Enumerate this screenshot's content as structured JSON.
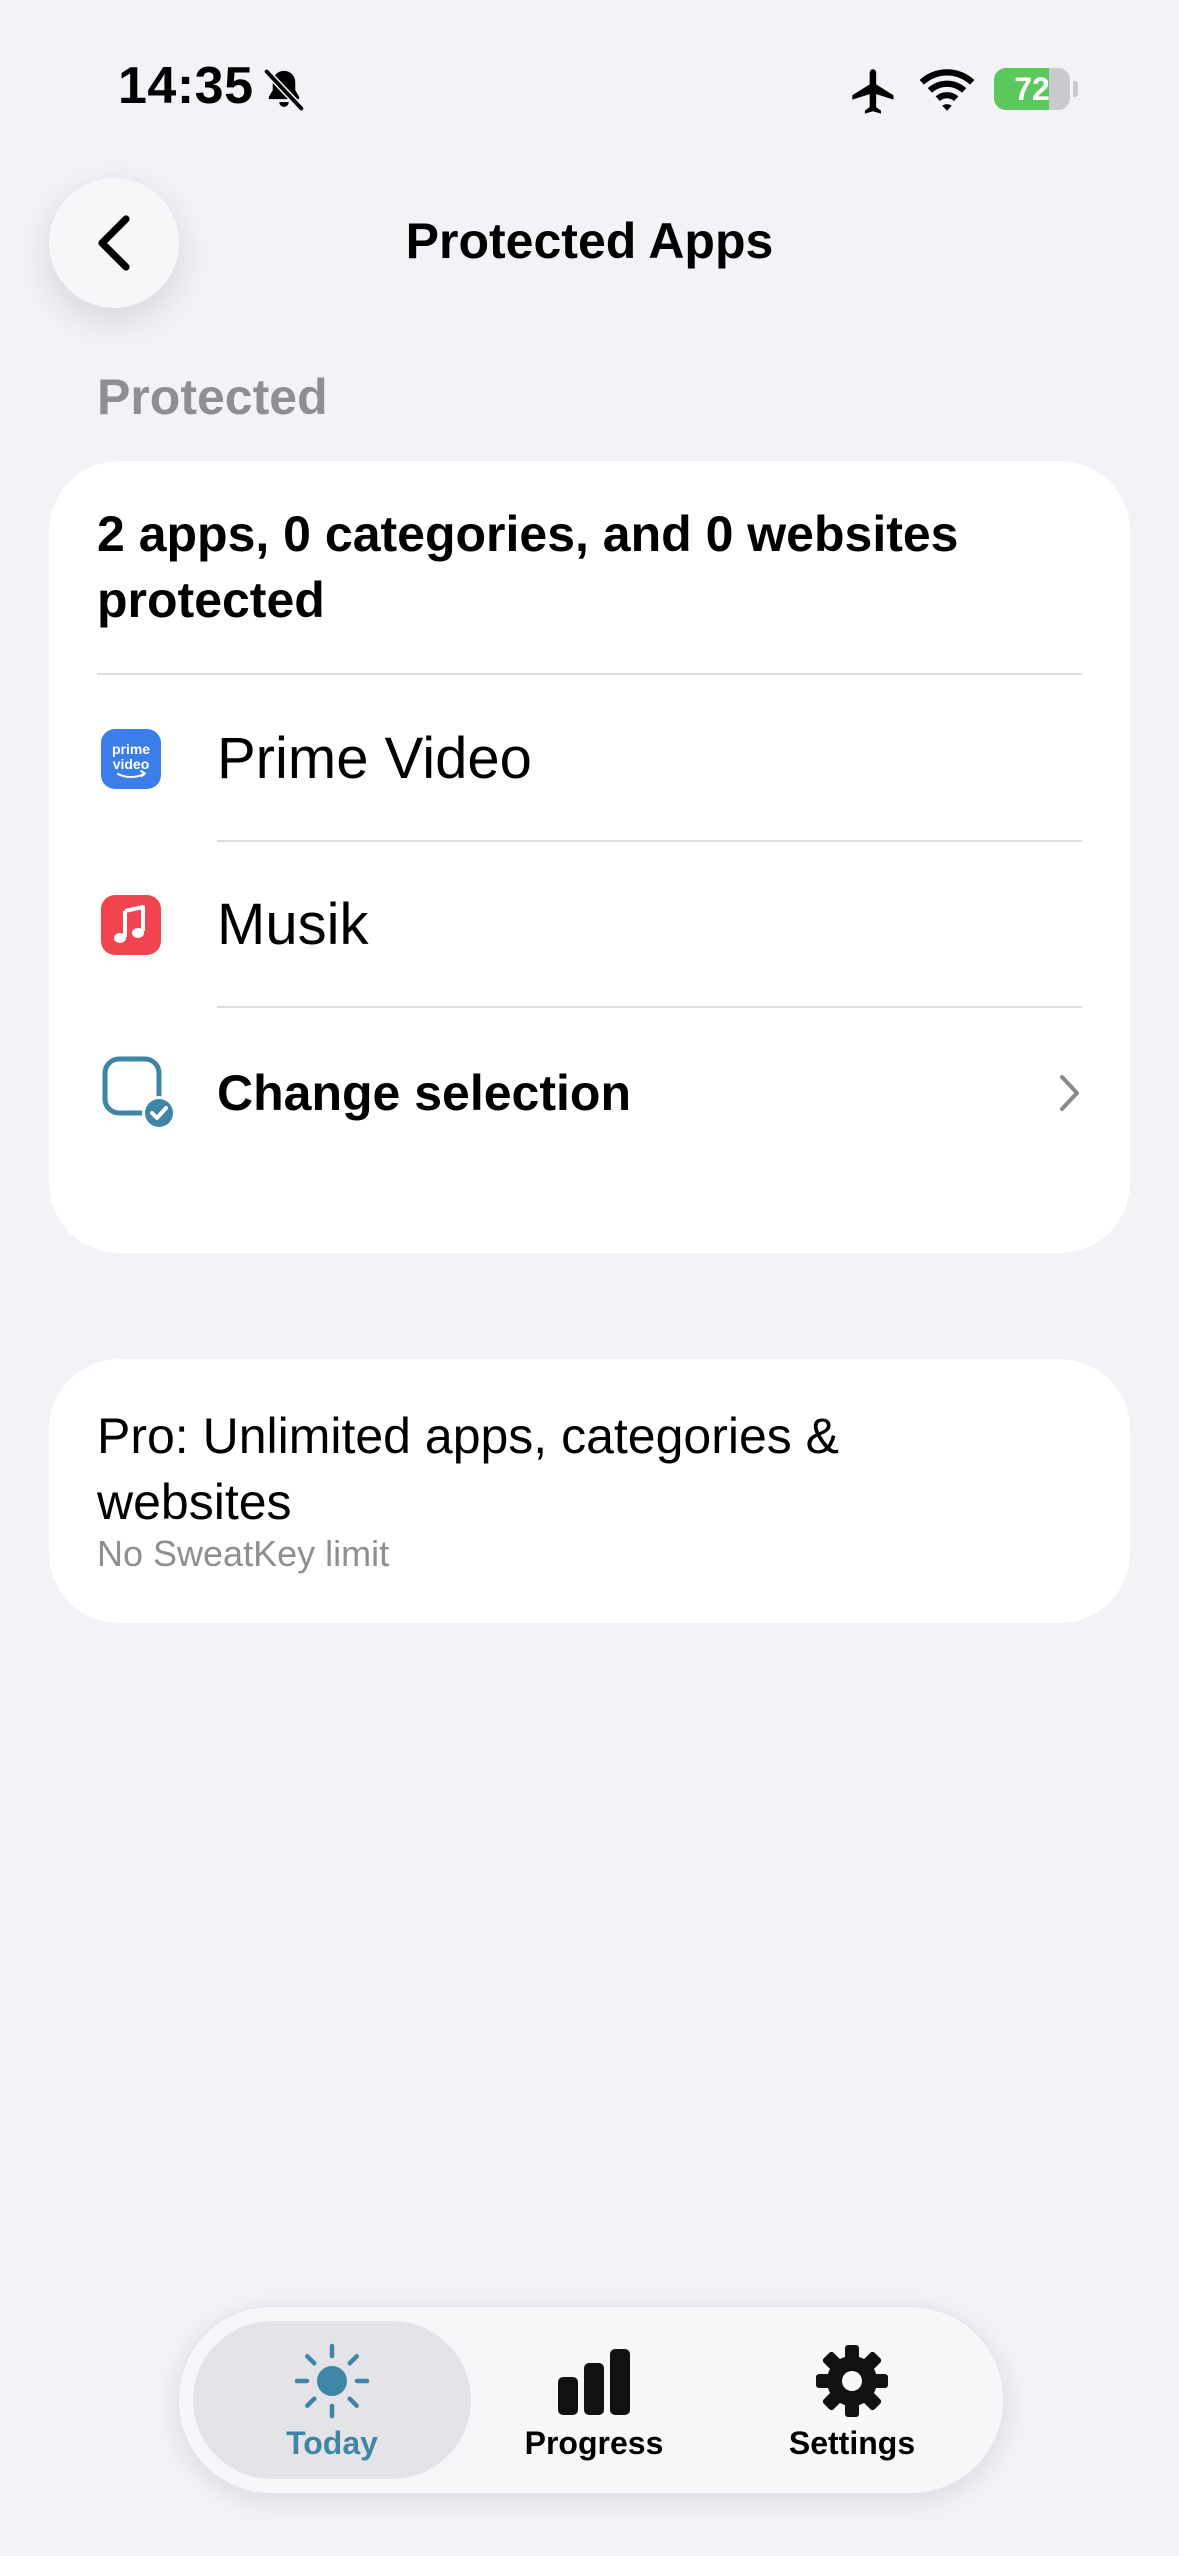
{
  "status_bar": {
    "time": "14:35",
    "battery": "72",
    "battery_level_percent": 72,
    "icons": [
      "bell-off-icon",
      "airplane-icon",
      "wifi-icon",
      "battery-charging-icon"
    ]
  },
  "nav": {
    "title": "Protected Apps",
    "back_icon": "chevron-left-icon"
  },
  "section": {
    "title": "Protected"
  },
  "protected_card": {
    "summary": "2 apps, 0 categories, and 0 websites protected",
    "apps": [
      {
        "name": "Prime Video",
        "icon": "prime-video-icon",
        "icon_text_line1": "prime",
        "icon_text_line2": "video",
        "color": "#3b7de9"
      },
      {
        "name": "Musik",
        "icon": "music-note-icon",
        "color": "#f0444f"
      }
    ],
    "change_selection": {
      "label": "Change selection",
      "icon": "checkbox-selection-icon",
      "color": "#3f86a6"
    }
  },
  "pro_card": {
    "title": "Pro: Unlimited apps, categories & websites",
    "subtitle": "No SweatKey limit"
  },
  "tab_bar": {
    "tabs": [
      {
        "label": "Today",
        "icon": "sun-icon",
        "active": true
      },
      {
        "label": "Progress",
        "icon": "bar-chart-icon",
        "active": false
      },
      {
        "label": "Settings",
        "icon": "gear-icon",
        "active": false
      }
    ],
    "accent_color": "#3f86a6"
  },
  "colors": {
    "background": "#f2f2f7",
    "card": "#ffffff",
    "secondary_text": "#8e8e93",
    "battery_green": "#5ac85a"
  }
}
